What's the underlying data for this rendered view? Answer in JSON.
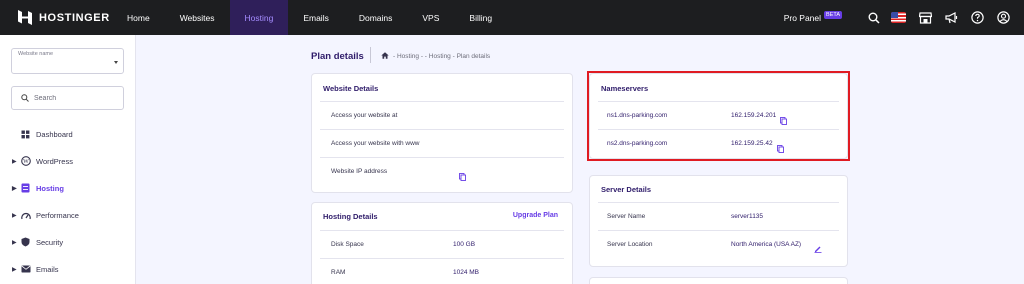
{
  "brand": {
    "name": "HOSTINGER"
  },
  "nav": {
    "items": [
      "Home",
      "Websites",
      "Hosting",
      "Emails",
      "Domains",
      "VPS",
      "Billing"
    ],
    "active": "Hosting",
    "pro_panel": "Pro Panel",
    "beta": "BETA"
  },
  "sidebar": {
    "select_label": "Website name",
    "search_placeholder": "Search",
    "items": [
      {
        "label": "Dashboard",
        "icon": "dashboard-icon"
      },
      {
        "label": "WordPress",
        "icon": "wordpress-icon"
      },
      {
        "label": "Hosting",
        "icon": "hosting-icon"
      },
      {
        "label": "Performance",
        "icon": "performance-icon"
      },
      {
        "label": "Security",
        "icon": "shield-icon"
      },
      {
        "label": "Emails",
        "icon": "email-icon"
      }
    ]
  },
  "page": {
    "title": "Plan details",
    "breadcrumb": "- Hosting - - Hosting - Plan details"
  },
  "website_details": {
    "title": "Website Details",
    "rows": [
      "Access your website at",
      "Access your website with www",
      "Website IP address"
    ]
  },
  "hosting_details": {
    "title": "Hosting Details",
    "link": "Upgrade Plan",
    "rows": [
      {
        "label": "Disk Space",
        "value": "100 GB"
      },
      {
        "label": "RAM",
        "value": "1024 MB"
      }
    ]
  },
  "nameservers": {
    "title": "Nameservers",
    "rows": [
      {
        "name": "ns1.dns-parking.com",
        "ip": "162.159.24.201"
      },
      {
        "name": "ns2.dns-parking.com",
        "ip": "162.159.25.42"
      }
    ]
  },
  "server_details": {
    "title": "Server Details",
    "rows": [
      {
        "label": "Server Name",
        "value": "server1135"
      },
      {
        "label": "Server Location",
        "value": "North America (USA AZ)"
      }
    ]
  },
  "colors": {
    "accent": "#673de6",
    "nav_bg": "#1d1e20",
    "highlight": "#e01b22"
  }
}
